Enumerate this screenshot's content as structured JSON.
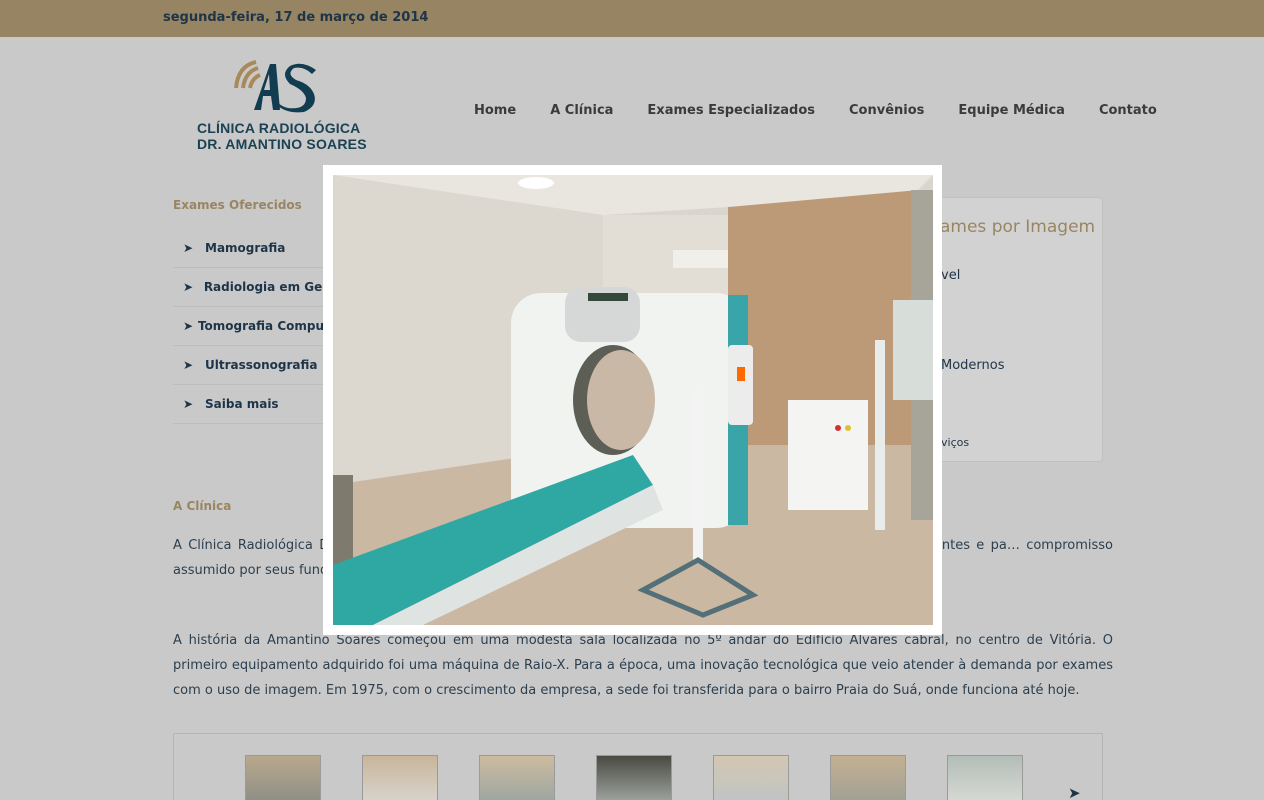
{
  "topbar": {
    "date": "segunda-feira, 17 de março de 2014"
  },
  "logo": {
    "monogram": "AS",
    "line1": "CLÍNICA  RADIOLÓGICA",
    "line2": "DR. AMANTINO SOARES"
  },
  "nav": [
    "Home",
    "A Clínica",
    "Exames Especializados",
    "Convênios",
    "Equipe Médica",
    "Contato"
  ],
  "sidebar": {
    "title": "Exames Oferecidos",
    "items": [
      "Mamografia",
      "Radiologia em Geral",
      "Tomografia Computadorizada",
      "Ultrassonografia",
      "Saiba mais"
    ]
  },
  "right_box": {
    "title": "ames por Imagem",
    "line1": "vel",
    "line2": "Modernos",
    "line3": "viços"
  },
  "section": {
    "title": "A Clínica",
    "p1": "A Clínica Radiológica Dr. Amantino Soares busca constantemente o aprimoramento no atendimento aos seus clientes e pa… compromisso assumido por seus fundadores que perman…",
    "p1_visible": "A Clínica Radiológica Dr                                                                                                  horamento no atendimento aos seus clientes e pa                                                                                   misso assumido por seus fundadores que perman",
    "p2": "A história da Amantino Soares começou em uma modesta sala localizada no 5º andar do Edifício Alvares cabral, no centro de Vitória. O primeiro equipamento adquirido foi uma máquina de Raio-X. Para a época, uma inovação tecnológica que veio atender à demanda por exames com o uso de imagem. Em 1975, com o crescimento da empresa, a sede foi transferida para o bairro Praia do Suá, onde funciona até hoje."
  },
  "gallery": {
    "thumb_count": 7,
    "next_icon": "next-arrow-icon"
  },
  "lightbox": {
    "image": "ct-scanner-photo"
  },
  "colors": {
    "topbar": "#968463",
    "accent": "#9a8563",
    "navy": "#1e3448",
    "background": "#c9c9c9"
  }
}
